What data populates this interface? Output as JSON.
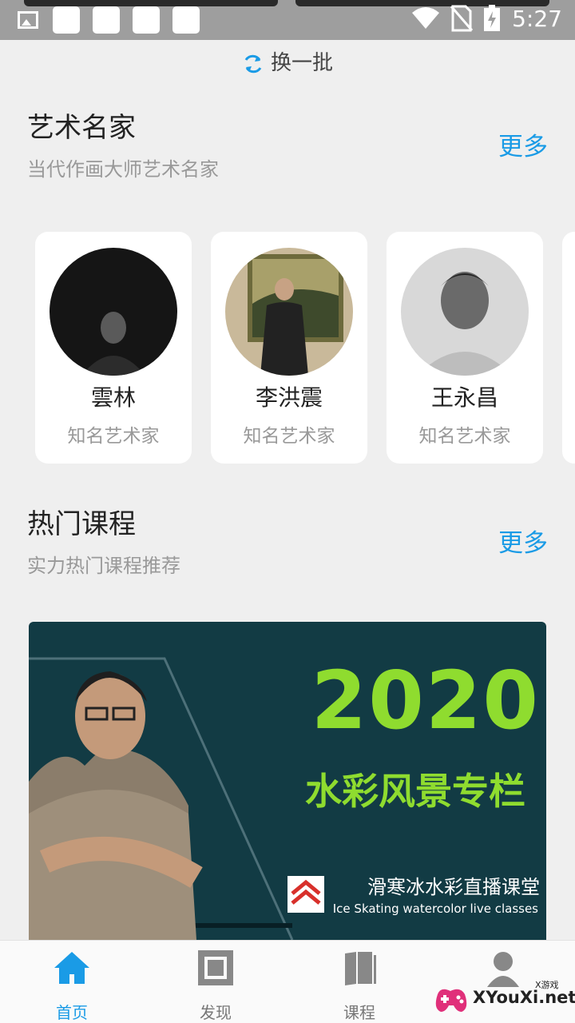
{
  "status_bar": {
    "time": "5:27"
  },
  "refresh": {
    "label": "换一批"
  },
  "artists_section": {
    "title": "艺术名家",
    "subtitle": "当代作画大师艺术名家",
    "more": "更多",
    "cards": [
      {
        "name": "雲林",
        "role": "知名艺术家"
      },
      {
        "name": "李洪震",
        "role": "知名艺术家"
      },
      {
        "name": "王永昌",
        "role": "知名艺术家"
      }
    ]
  },
  "courses_section": {
    "title": "热门课程",
    "subtitle": "实力热门课程推荐",
    "more": "更多",
    "banner": {
      "year": "2020",
      "title": "水彩风景专栏",
      "brand": "滑寒冰水彩直播课堂",
      "brand_en": "Ice Skating watercolor live classes"
    }
  },
  "bottom_nav": [
    {
      "label": "首页",
      "icon": "home-icon",
      "active": true
    },
    {
      "label": "发现",
      "icon": "discover-icon",
      "active": false
    },
    {
      "label": "课程",
      "icon": "book-icon",
      "active": false
    },
    {
      "label": "",
      "icon": "user-icon",
      "active": false
    }
  ],
  "watermark": {
    "text": "XYouXi.net",
    "small": "X游戏"
  },
  "colors": {
    "accent": "#1a9be6",
    "banner_bg": "#123b44",
    "banner_green": "#8fdc2f"
  }
}
